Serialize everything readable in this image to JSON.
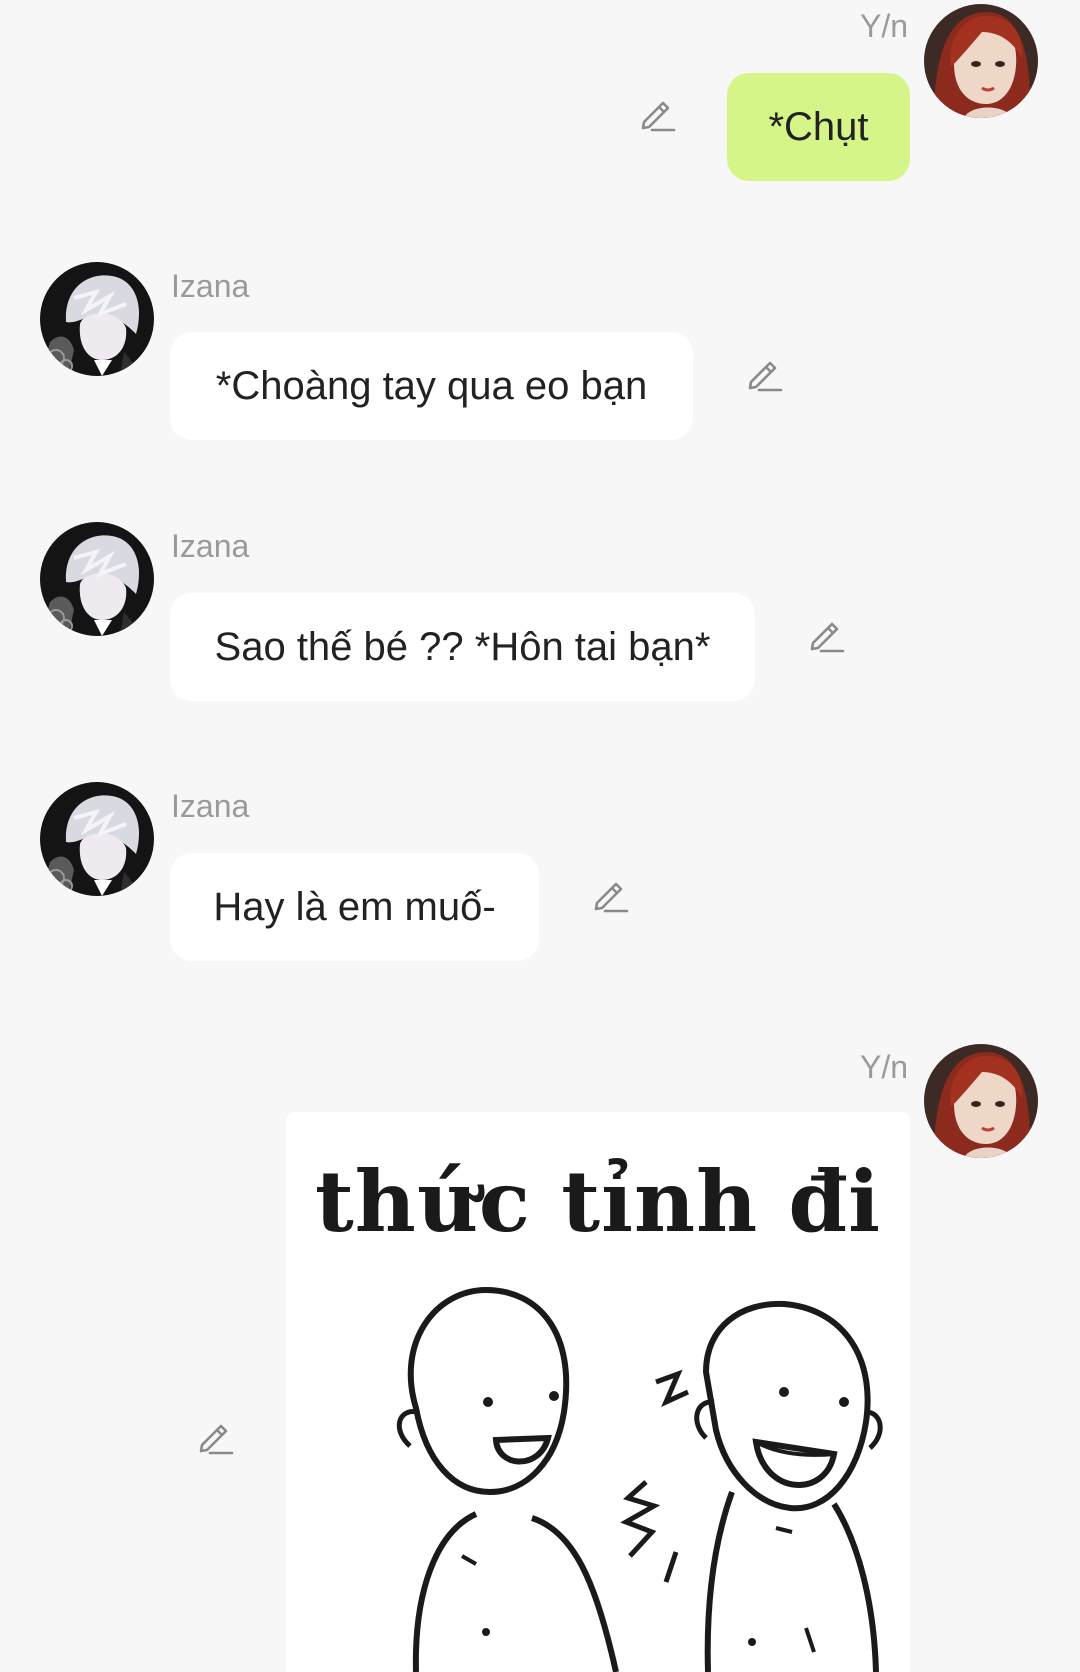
{
  "messages": [
    {
      "sender": "Y/n",
      "text": "*Chụt",
      "direction": "outgoing"
    },
    {
      "sender": "Izana",
      "text": "*Choàng tay qua eo bạn",
      "direction": "incoming"
    },
    {
      "sender": "Izana",
      "text": "Sao thế bé ?? *Hôn tai bạn*",
      "direction": "incoming"
    },
    {
      "sender": "Izana",
      "text": "Hay là em muố-",
      "direction": "incoming"
    },
    {
      "sender": "Y/n",
      "sticker_caption": "thức tỉnh đi",
      "direction": "outgoing"
    }
  ],
  "colors": {
    "background": "#f7f7f7",
    "incoming_bubble": "#ffffff",
    "outgoing_bubble": "#d6f588",
    "sender_name": "#9a9a9a",
    "icon": "#8a8a8a"
  },
  "icons": {
    "edit": "pencil-edit-icon"
  }
}
